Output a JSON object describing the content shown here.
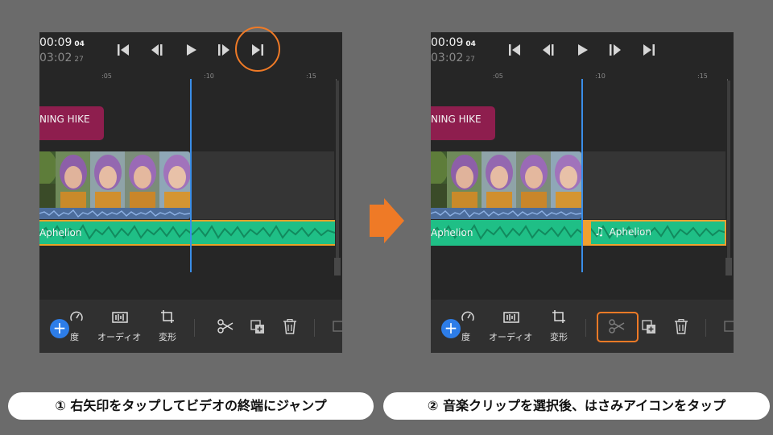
{
  "left_panel": {
    "timecode_current": "00:09",
    "timecode_current_frames": "04",
    "timecode_total": "03:02",
    "timecode_total_frames": "27",
    "ruler": [
      ":05",
      ":10",
      ":15"
    ],
    "title_clip_text": "NING HIKE",
    "audio_clip_name": "Aphelion"
  },
  "right_panel": {
    "timecode_current": "00:09",
    "timecode_current_frames": "04",
    "timecode_total": "03:02",
    "timecode_total_frames": "27",
    "ruler": [
      ":05",
      ":10",
      ":15"
    ],
    "title_clip_text": "NING HIKE",
    "audio_clip_name": "Aphelion",
    "audio_clip_name_split": "Aphelion",
    "note_glyph": "♫"
  },
  "toolbar": {
    "speed_label": "度",
    "audio_label": "オーディオ",
    "transform_label": "変形",
    "add_glyph": "+"
  },
  "transport_icons": [
    "skip-to-start-icon",
    "step-back-icon",
    "play-icon",
    "step-forward-icon",
    "skip-to-end-icon"
  ],
  "colors": {
    "highlight": "#ef7a26",
    "playhead": "#3a8ee8",
    "audio_clip": "#1fbf86",
    "title_clip": "#8e1e4e",
    "add_button": "#2d7de8"
  },
  "captions": {
    "step1": "① 右矢印をタップしてビデオの終端にジャンプ",
    "step2": "② 音楽クリップを選択後、はさみアイコンをタップ"
  }
}
